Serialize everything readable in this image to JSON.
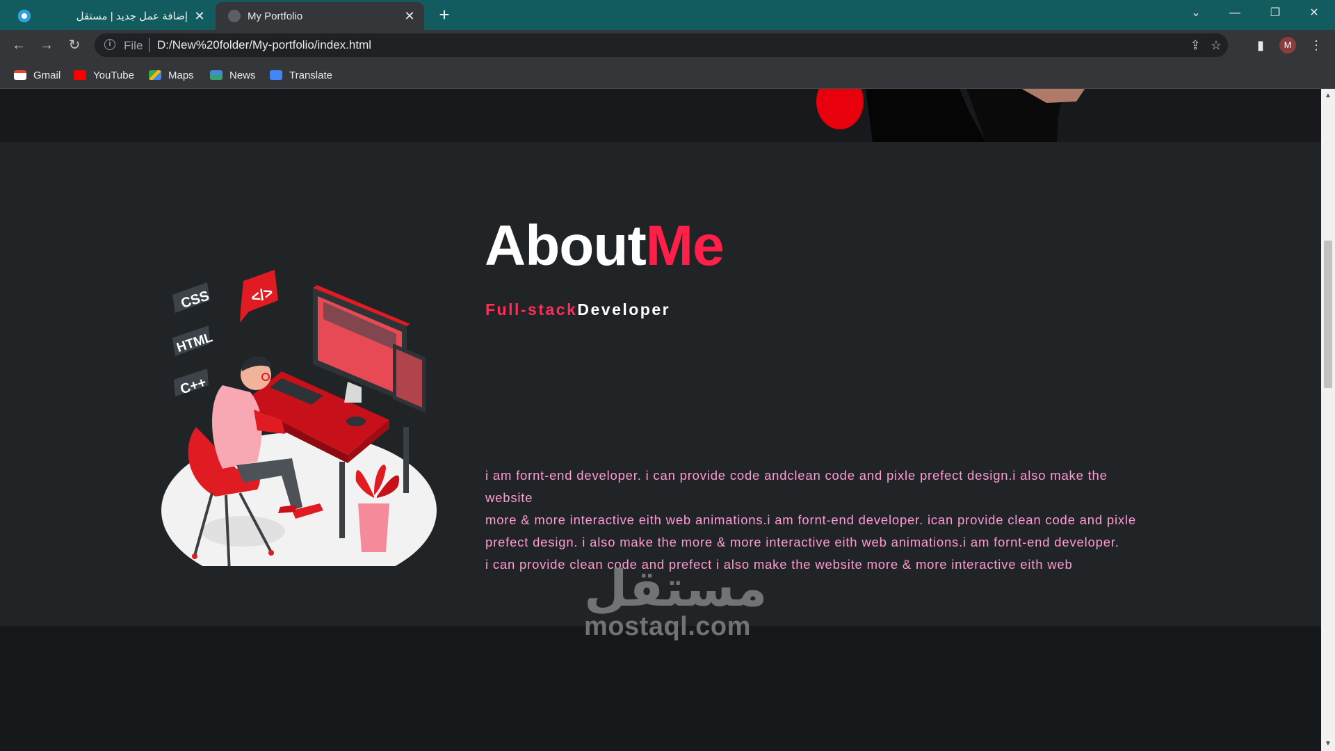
{
  "browser": {
    "tabs": [
      {
        "title": "إضافة عمل جديد | مستقل",
        "close": "✕",
        "favicon": "mostaql-favicon"
      },
      {
        "title": "My Portfolio",
        "close": "✕",
        "favicon": "portfolio-favicon"
      }
    ],
    "new_tab": "+",
    "window_controls": {
      "tab_search": "⌄",
      "minimize": "—",
      "restore": "❐",
      "close": "✕"
    },
    "nav": {
      "back": "←",
      "forward": "→",
      "reload": "↻"
    },
    "address": {
      "info_icon": "i",
      "scheme": "File",
      "url": "D:/New%20folder/My-portfolio/index.html"
    },
    "actions": {
      "share": "⇪",
      "bookmark": "☆",
      "side_panel": "▮",
      "menu": "⋮"
    },
    "profile": "M",
    "bookmarks": [
      {
        "label": "Gmail",
        "color": "#ea4335"
      },
      {
        "label": "YouTube",
        "color": "#ff0000"
      },
      {
        "label": "Maps",
        "color": "#34a853"
      },
      {
        "label": "News",
        "color": "#4285f4"
      },
      {
        "label": "Translate",
        "color": "#4285f4"
      }
    ]
  },
  "about": {
    "title_part1": "About",
    "title_part2": "Me",
    "subtitle_part1": "Full-stack",
    "subtitle_part2": "Developer",
    "paragraph_lines": [
      "i am fornt-end developer. i can provide code andclean code and pixle prefect design.i also make the website",
      "more & more interactive eith web animations.i am fornt-end developer. ican provide clean code and pixle prefect design. i also make the more & more interactive eith web animations.i am fornt-end developer.",
      "i can provide clean code and prefect i also make the website more & more interactive eith web"
    ],
    "illustration_labels": {
      "css": "CSS",
      "html": "HTML",
      "cpp": "C++",
      "code": "</>"
    }
  },
  "watermark": {
    "arabic": "مستقل",
    "latin": "mostaql.com"
  },
  "colors": {
    "accent": "#ff1f48",
    "paragraph": "#ff9ad2",
    "tab_bar": "#125c5f"
  }
}
